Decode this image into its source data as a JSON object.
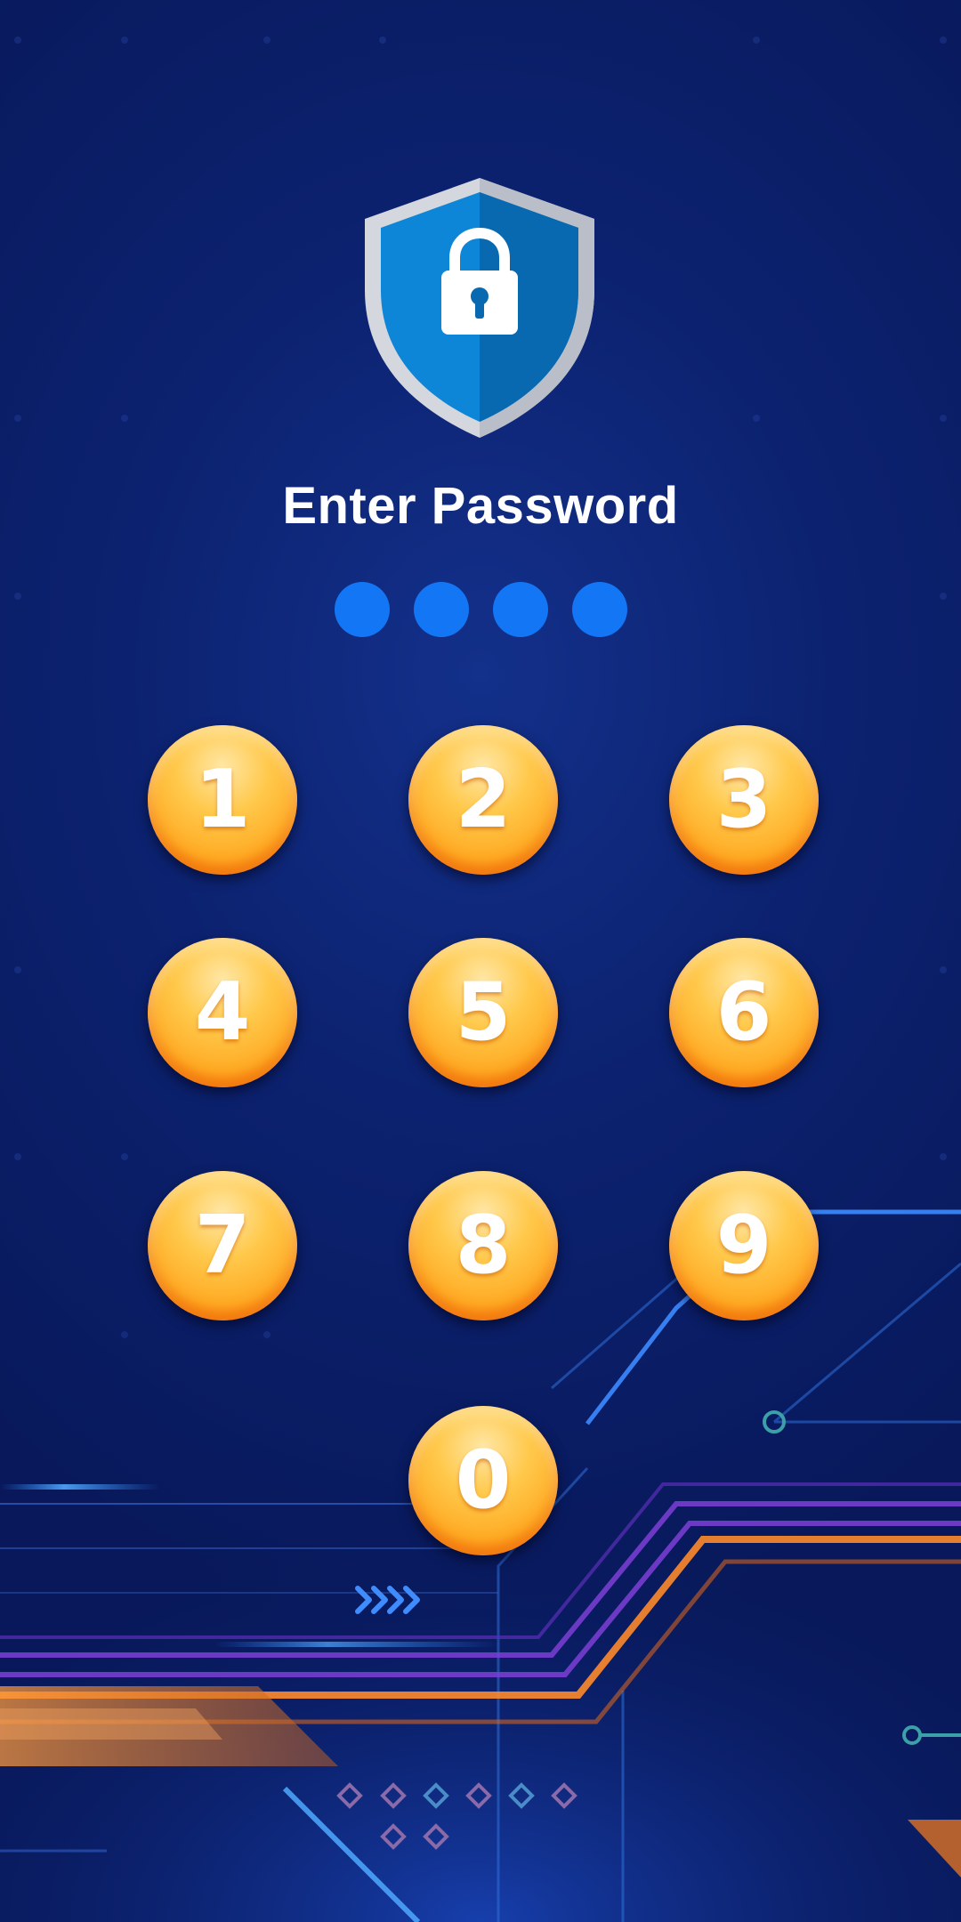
{
  "title": "Enter Password",
  "pin": {
    "length": 4,
    "filled": 4
  },
  "keypad": [
    "1",
    "2",
    "3",
    "4",
    "5",
    "6",
    "7",
    "8",
    "9",
    "0"
  ],
  "colors": {
    "background": "#0b1f63",
    "pin_dot": "#1276f5",
    "key_light": "#ffd46a",
    "key_dark": "#ff7d0a",
    "shield_blue": "#0d7fd4",
    "shield_rim": "#d4d7de"
  },
  "icons": {
    "logo": "shield-lock-icon"
  }
}
